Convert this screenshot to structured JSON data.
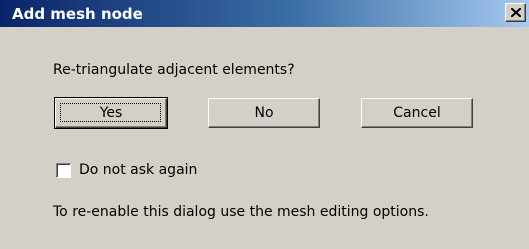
{
  "window": {
    "title": "Add mesh node",
    "close_icon": "close-x-icon"
  },
  "dialog": {
    "question": "Re-triangulate adjacent elements?",
    "buttons": {
      "yes": "Yes",
      "no": "No",
      "cancel": "Cancel"
    },
    "checkbox": {
      "label": "Do not ask again",
      "checked": false
    },
    "info": "To re-enable this dialog use the mesh editing options."
  },
  "colors": {
    "titlebar_start": "#0a246a",
    "titlebar_end": "#a6caf0",
    "face": "#d4d0c8"
  }
}
